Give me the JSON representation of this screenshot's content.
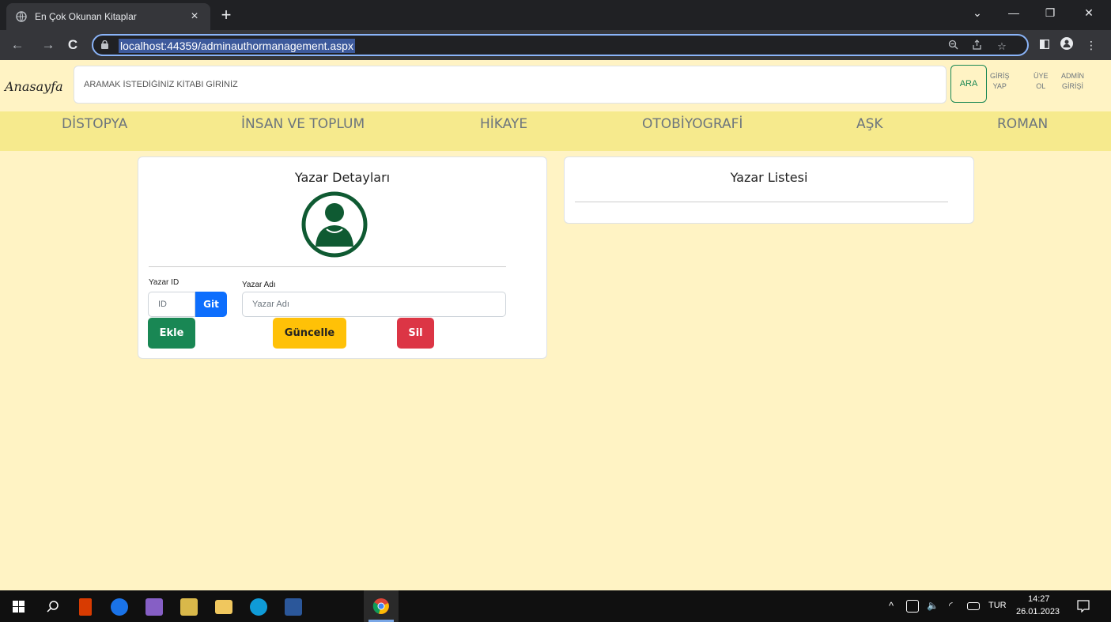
{
  "browser": {
    "tab_title": "En Çok Okunan Kitaplar",
    "tab_close": "×",
    "new_tab": "+",
    "url": "localhost:44359/adminauthormanagement.aspx",
    "controls": {
      "minimize": "—",
      "restore": "❐",
      "close": "✕",
      "tabsearch": "⌄"
    },
    "nav": {
      "back": "←",
      "forward": "→",
      "reload": "C"
    },
    "icons": [
      "zoom-icon",
      "share-icon",
      "bookmark-star-icon",
      "sidepanel-icon",
      "profile-icon",
      "menu-kebab-icon"
    ]
  },
  "header": {
    "brand": "Anasayfa",
    "search_placeholder": "ARAMAK İSTEDİĞİNİZ KİTABI GİRİNİZ",
    "search_button": "ARA",
    "login_line1": "GİRİŞ",
    "login_line2": "YAP",
    "signup_line1": "ÜYE",
    "signup_line2": "OL",
    "admin_line1": "ADMİN",
    "admin_line2": "GİRİŞİ"
  },
  "categories": [
    "DİSTOPYA",
    "İNSAN VE TOPLUM",
    "HİKAYE",
    "OTOBİYOGRAFİ",
    "AŞK",
    "ROMAN"
  ],
  "author_details": {
    "title": "Yazar Detayları",
    "id_label": "Yazar ID",
    "id_placeholder": "ID",
    "go_button": "Git",
    "name_label": "Yazar Adı",
    "name_placeholder": "Yazar Adı",
    "add_button": "Ekle",
    "update_button": "Güncelle",
    "delete_button": "Sil"
  },
  "author_list": {
    "title": "Yazar Listesi"
  },
  "taskbar": {
    "language": "TUR",
    "time": "14:27",
    "date": "26.01.2023"
  },
  "colors": {
    "page_bg": "#fff3c4",
    "nav_bg": "#f6ea8d",
    "success": "#198754",
    "primary": "#0d6efd",
    "warning": "#ffc107",
    "danger": "#dc3545",
    "avatar": "#0f5a32"
  }
}
